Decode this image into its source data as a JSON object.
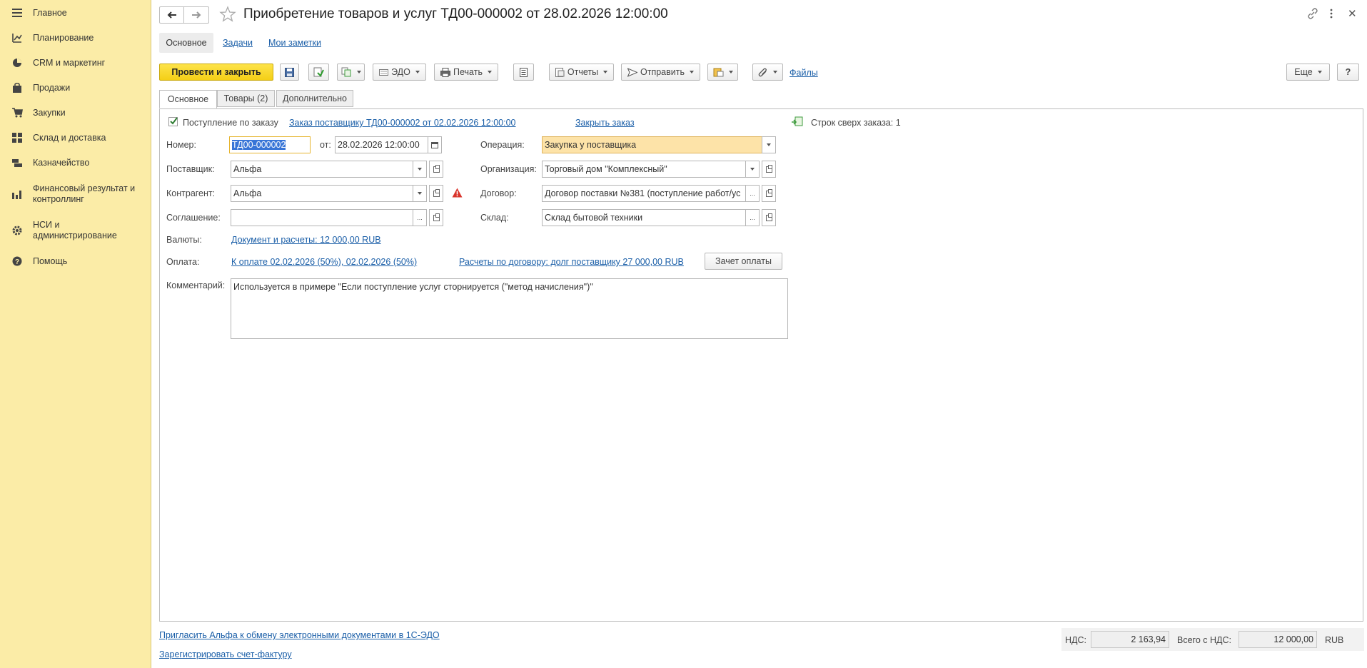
{
  "sidebar": {
    "items": [
      {
        "label": "Главное",
        "icon": "menu-icon"
      },
      {
        "label": "Планирование",
        "icon": "planning-icon"
      },
      {
        "label": "CRM и маркетинг",
        "icon": "pie-chart-icon"
      },
      {
        "label": "Продажи",
        "icon": "bag-icon"
      },
      {
        "label": "Закупки",
        "icon": "cart-icon"
      },
      {
        "label": "Склад и доставка",
        "icon": "warehouse-icon"
      },
      {
        "label": "Казначейство",
        "icon": "treasury-icon"
      },
      {
        "label": "Финансовый результат и контроллинг",
        "icon": "bar-chart-icon"
      },
      {
        "label": "НСИ и администрирование",
        "icon": "gear-icon"
      },
      {
        "label": "Помощь",
        "icon": "help-icon"
      }
    ]
  },
  "header": {
    "title": "Приобретение товаров и услуг ТД00-000002 от 28.02.2026 12:00:00",
    "nav_tabs": [
      "Основное",
      "Задачи",
      "Мои заметки"
    ]
  },
  "toolbar": {
    "post_close": "Провести и закрыть",
    "edo": "ЭДО",
    "print": "Печать",
    "reports": "Отчеты",
    "send": "Отправить",
    "files": "Файлы",
    "more": "Еще",
    "help": "?"
  },
  "tabs": [
    "Основное",
    "Товары (2)",
    "Дополнительно"
  ],
  "form": {
    "by_order_label": "Поступление по заказу",
    "by_order_checked": true,
    "order_link": "Заказ поставщику ТД00-000002 от 02.02.2026 12:00:00",
    "close_order_link": "Закрыть заказ",
    "extra_rows": "Строк сверх заказа: 1",
    "number_label": "Номер:",
    "number_value": "ТД00-000002",
    "date_label": "от:",
    "date_value": "28.02.2026 12:00:00",
    "operation_label": "Операция:",
    "operation_value": "Закупка у поставщика",
    "supplier_label": "Поставщик:",
    "supplier_value": "Альфа",
    "organization_label": "Организация:",
    "organization_value": "Торговый дом \"Комплексный\"",
    "counterparty_label": "Контрагент:",
    "counterparty_value": "Альфа",
    "contract_label": "Договор:",
    "contract_value": "Договор поставки №381 (поступление работ/ус",
    "agreement_label": "Соглашение:",
    "agreement_value": "",
    "warehouse_label": "Склад:",
    "warehouse_value": "Склад бытовой техники",
    "currency_label": "Валюты:",
    "currency_link": "Документ и расчеты: 12 000,00 RUB",
    "payment_label": "Оплата:",
    "payment_link": "К оплате 02.02.2026 (50%), 02.02.2026 (50%)",
    "settlements_link": "Расчеты по договору: долг поставщику 27 000,00 RUB",
    "offset_button": "Зачет оплаты",
    "comment_label": "Комментарий:",
    "comment_value": "Используется в примере \"Если поступление услуг сторнируется (\"метод начисления\")\""
  },
  "footer": {
    "invite_link": "Пригласить Альфа к обмену электронными документами в 1С-ЭДО",
    "register_link": "Зарегистрировать счет-фактуру",
    "vat_label": "НДС:",
    "vat_value": "2 163,94",
    "total_label": "Всего с НДС:",
    "total_value": "12 000,00",
    "currency": "RUB"
  }
}
